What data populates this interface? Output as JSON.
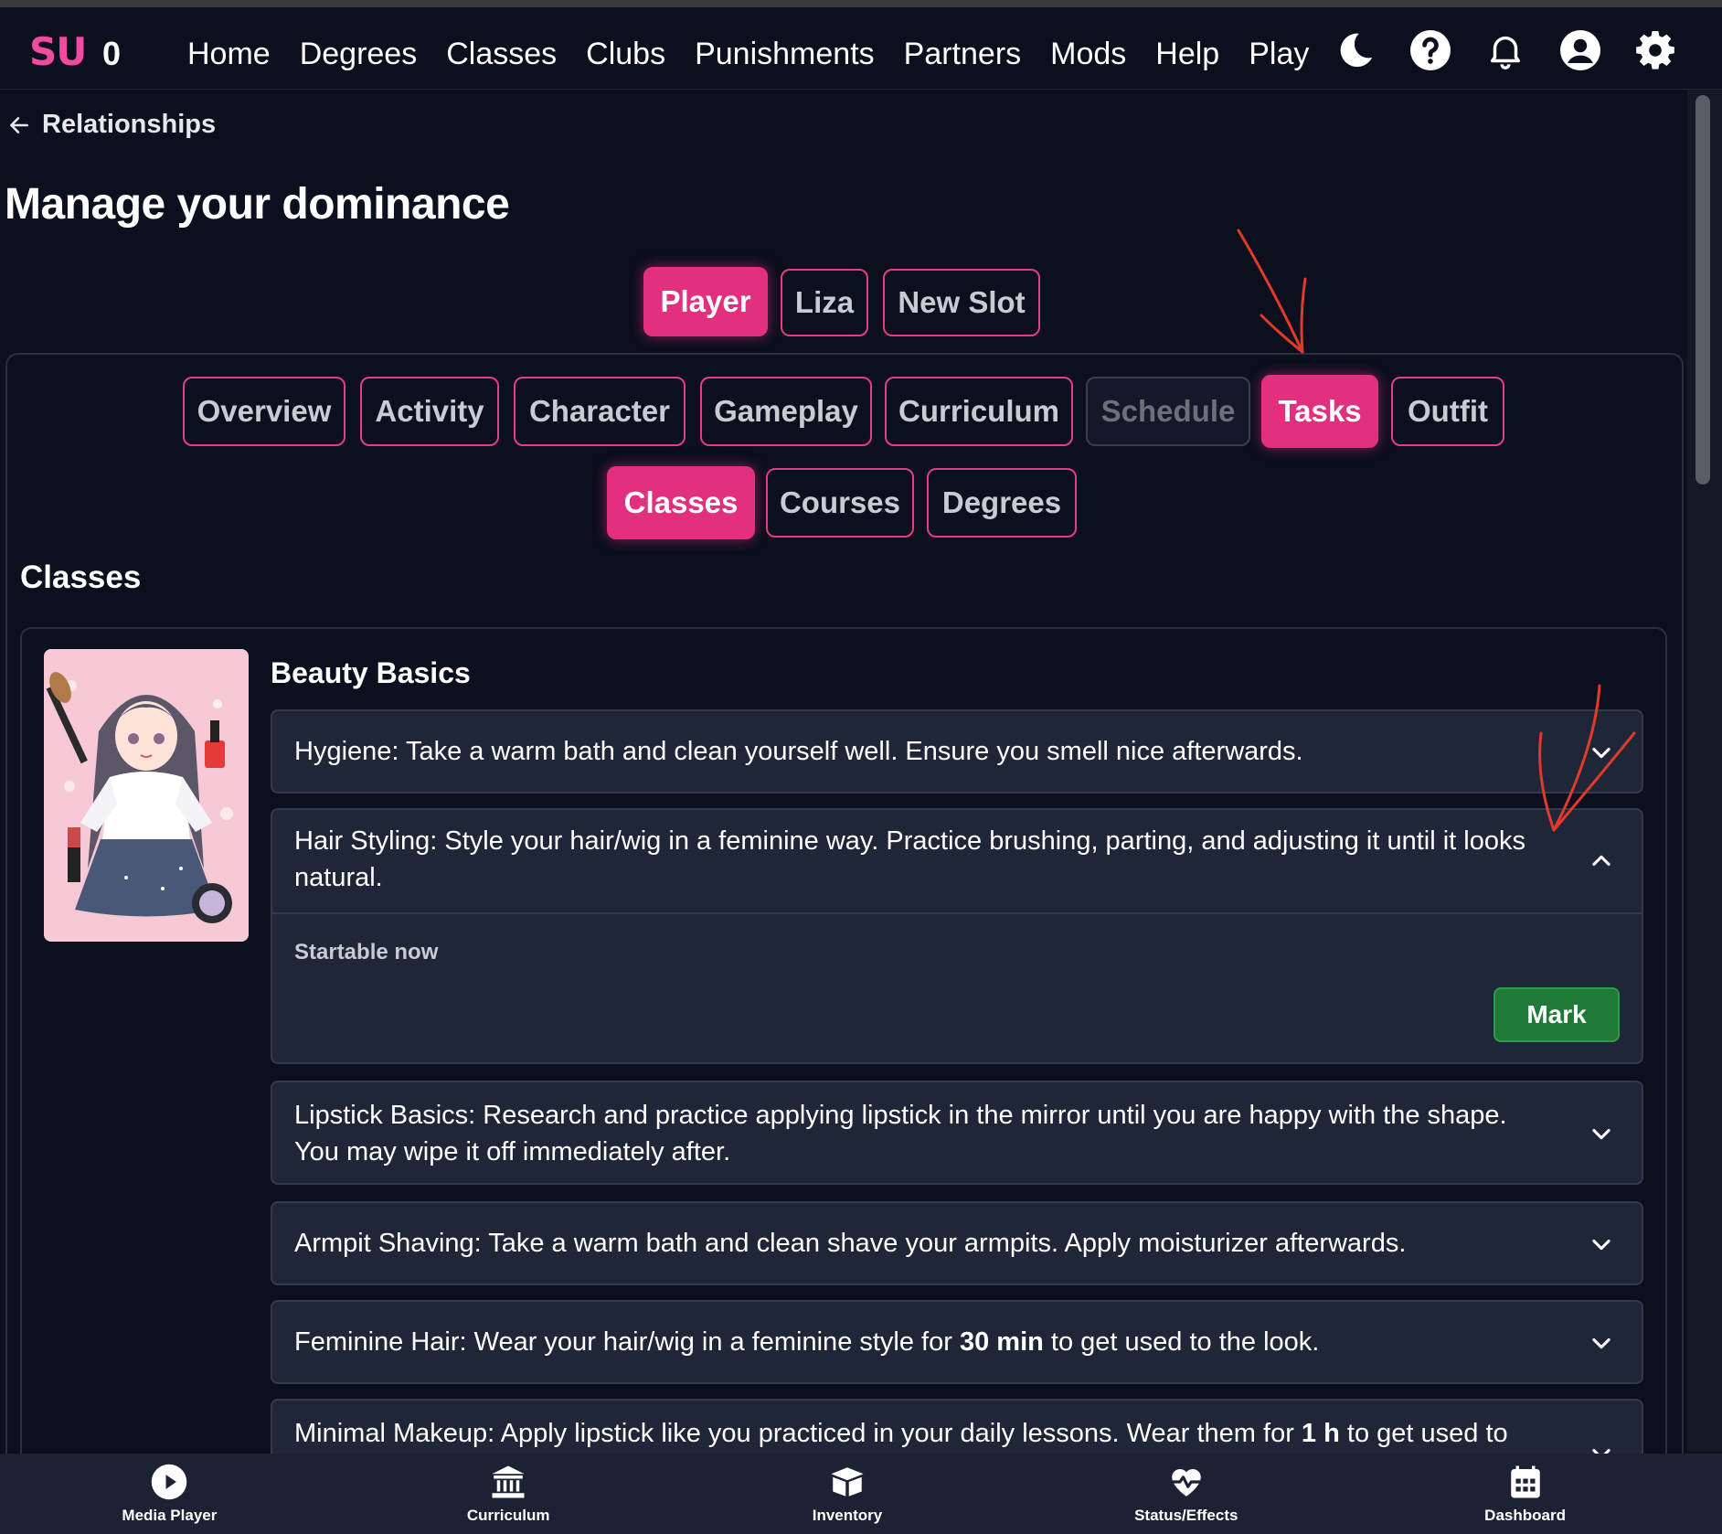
{
  "brand": {
    "logo": "SU",
    "count": "0"
  },
  "nav": [
    "Home",
    "Degrees",
    "Classes",
    "Clubs",
    "Punishments",
    "Partners",
    "Mods",
    "Help",
    "Play"
  ],
  "top_icons": [
    "moon-icon",
    "help-circle-icon",
    "bell-icon",
    "user-circle-icon",
    "gear-icon"
  ],
  "back_link": "Relationships",
  "page_title": "Manage your dominance",
  "slots": [
    {
      "label": "Player",
      "active": true
    },
    {
      "label": "Liza",
      "active": false
    },
    {
      "label": "New Slot",
      "active": false
    }
  ],
  "tabs": [
    {
      "label": "Overview",
      "state": "normal"
    },
    {
      "label": "Activity",
      "state": "normal"
    },
    {
      "label": "Character",
      "state": "normal"
    },
    {
      "label": "Gameplay",
      "state": "normal"
    },
    {
      "label": "Curriculum",
      "state": "normal"
    },
    {
      "label": "Schedule",
      "state": "disabled"
    },
    {
      "label": "Tasks",
      "state": "active"
    },
    {
      "label": "Outfit",
      "state": "normal"
    }
  ],
  "subtabs": [
    {
      "label": "Classes",
      "active": true
    },
    {
      "label": "Courses",
      "active": false
    },
    {
      "label": "Degrees",
      "active": false
    }
  ],
  "section_title": "Classes",
  "class": {
    "name": "Beauty Basics",
    "tasks": [
      {
        "text": "Hygiene: Take a warm bath and clean yourself well. Ensure you smell nice afterwards.",
        "expanded": false
      },
      {
        "line1": "Hair Styling: Style your hair/wig in a feminine way. Practice brushing, parting, and adjusting it until it looks",
        "line2": "natural.",
        "expanded": true,
        "status": "Startable now",
        "action": "Mark"
      },
      {
        "line1": "Lipstick Basics: Research and practice applying lipstick in the mirror until you are happy with the shape.",
        "line2": "You may wipe it off immediately after.",
        "expanded": false
      },
      {
        "text": "Armpit Shaving: Take a warm bath and clean shave your armpits. Apply moisturizer afterwards.",
        "expanded": false
      },
      {
        "pre": "Feminine Hair: Wear your hair/wig in a feminine style for ",
        "bold": "30 min",
        "post": " to get used to the look.",
        "expanded": false
      },
      {
        "pre": "Minimal Makeup: Apply lipstick like you practiced in your daily lessons. Wear them for ",
        "bold": "1 h",
        "post": " to get used to",
        "expanded": false
      }
    ]
  },
  "bottom_nav": [
    {
      "label": "Media Player",
      "icon": "play-circle-icon"
    },
    {
      "label": "Curriculum",
      "icon": "institution-icon"
    },
    {
      "label": "Inventory",
      "icon": "box-icon"
    },
    {
      "label": "Status/Effects",
      "icon": "heart-pulse-icon"
    },
    {
      "label": "Dashboard",
      "icon": "calendar-icon"
    }
  ],
  "colors": {
    "accent": "#e2307f",
    "brand": "#f14aa0",
    "success": "#1e7a36",
    "background": "#0c0f1d",
    "card": "#1f2638"
  }
}
